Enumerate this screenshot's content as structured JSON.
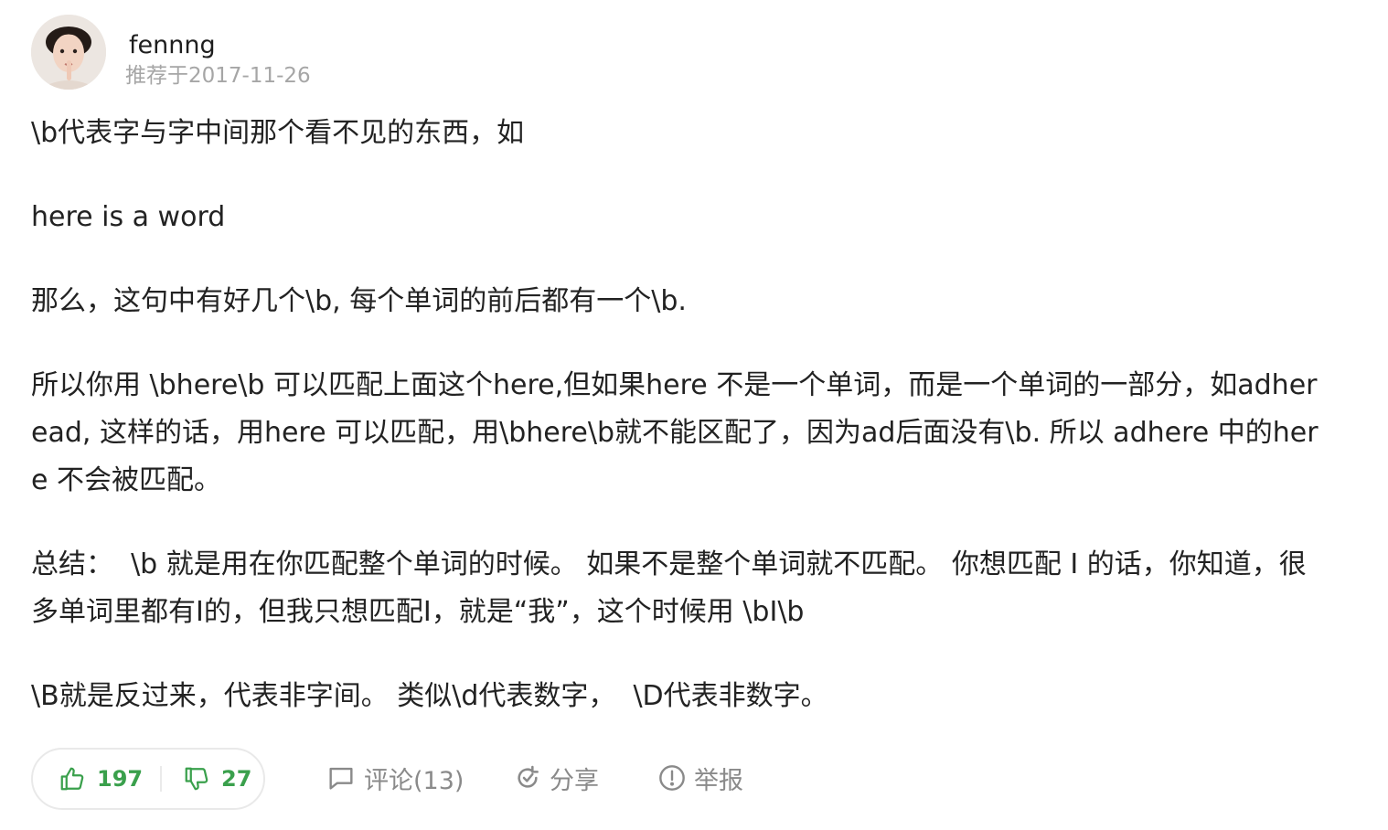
{
  "author": {
    "name": "fennng",
    "date": "推荐于2017-11-26"
  },
  "content": {
    "paragraphs": [
      "\\b代表字与字中间那个看不见的东西，如",
      "here is a word",
      "那么，这句中有好几个\\b, 每个单词的前后都有一个\\b.",
      "所以你用 \\bhere\\b 可以匹配上面这个here,但如果here 不是一个单词，而是一个单词的一部分，如adheread, 这样的话，用here 可以匹配，用\\bhere\\b就不能区配了，因为ad后面没有\\b. 所以 adhere 中的here 不会被匹配。",
      "总结：  \\b 就是用在你匹配整个单词的时候。 如果不是整个单词就不匹配。 你想匹配 I 的话，你知道，很多单词里都有I的，但我只想匹配I，就是“我”，这个时候用 \\bI\\b",
      "\\B就是反过来，代表非字间。 类似\\d代表数字，  \\D代表非数字。"
    ]
  },
  "actions": {
    "upvote_count": "197",
    "downvote_count": "27",
    "comment_label": "评论(13)",
    "share_label": "分享",
    "report_label": "举报"
  },
  "colors": {
    "accent_green": "#3aa04c",
    "muted_gray": "#8a8a8a",
    "date_gray": "#a6a6a6"
  },
  "icons": {
    "upvote": "thumbs-up-icon",
    "downvote": "thumbs-down-icon",
    "comment": "comment-icon",
    "share": "share-icon",
    "report": "report-icon"
  }
}
